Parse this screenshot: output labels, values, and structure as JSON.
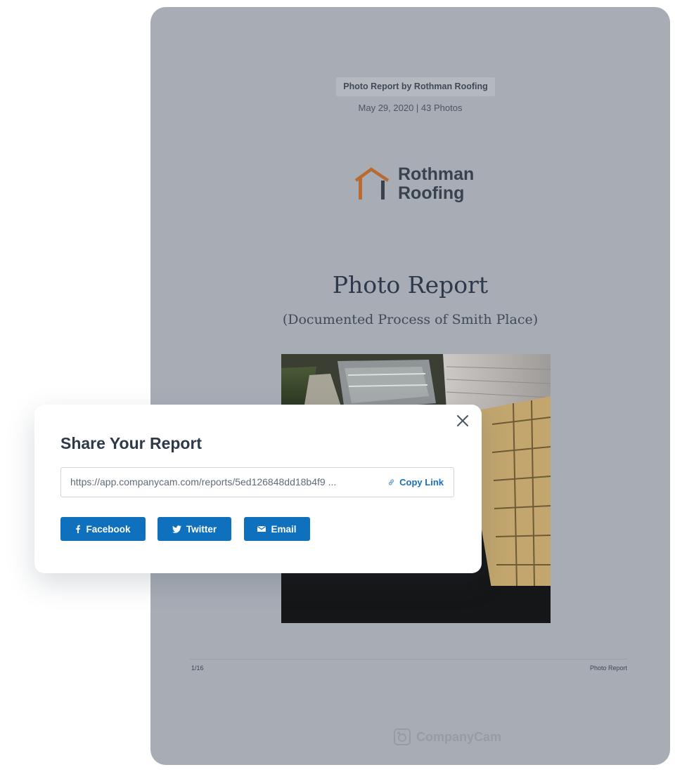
{
  "report": {
    "badge": "Photo Report by Rothman Roofing",
    "meta": "May 29, 2020 | 43 Photos",
    "logo": {
      "line1": "Rothman",
      "line2": "Roofing"
    },
    "title": "Photo Report",
    "subtitle": "(Documented Process of Smith Place)",
    "page_number": "1/16",
    "page_label": "Photo Report",
    "footer_brand": "CompanyCam"
  },
  "share_modal": {
    "title": "Share Your Report",
    "link_value": "https://app.companycam.com/reports/5ed126848dd18b4f9 ...",
    "copy_label": "Copy Link",
    "buttons": {
      "facebook": "Facebook",
      "twitter": "Twitter",
      "email": "Email"
    }
  },
  "icons": [
    "house-logo-icon",
    "photo",
    "companycam-logo-icon",
    "close-icon",
    "link-icon",
    "facebook-icon",
    "twitter-icon",
    "email-icon"
  ],
  "colors": {
    "report_background": "#a8adb5",
    "logo_orange": "#b86a30",
    "button_blue": "#0f70bd",
    "link_blue": "#1b70b5",
    "heading_dark": "#2d3a4b"
  }
}
